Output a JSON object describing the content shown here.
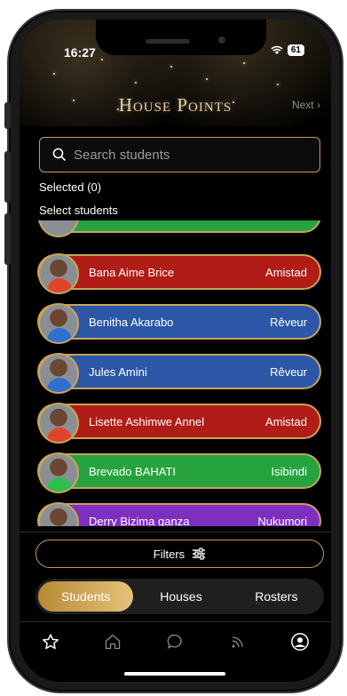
{
  "status": {
    "time": "16:27",
    "battery": "61"
  },
  "header": {
    "title": "House Points",
    "next_label": "Next"
  },
  "search": {
    "placeholder": "Search students"
  },
  "selection": {
    "count_label": "Selected (0)",
    "header": "Select students"
  },
  "students": [
    {
      "name": "Bana Aime Brice",
      "house": "Amistad",
      "color": "#b01c16",
      "shirt": "#e0452a"
    },
    {
      "name": "Benitha Akarabo",
      "house": "Rêveur",
      "color": "#2c57a6",
      "shirt": "#2e6fd0"
    },
    {
      "name": "Jules Amini",
      "house": "Rêveur",
      "color": "#2c57a6",
      "shirt": "#2e6fd0"
    },
    {
      "name": "Lisette Ashimwe Annel",
      "house": "Amistad",
      "color": "#b01c16",
      "shirt": "#e0452a"
    },
    {
      "name": "Brevado BAHATI",
      "house": "Isibindi",
      "color": "#26a33f",
      "shirt": "#2fbe4b"
    },
    {
      "name": "Derry Bizima ganza",
      "house": "Nukumori",
      "color": "#7f2fc0",
      "shirt": "#9b3fe0"
    }
  ],
  "partial_row_color": "#26a33f",
  "filters": {
    "label": "Filters"
  },
  "segments": {
    "students": "Students",
    "houses": "Houses",
    "rosters": "Rosters"
  },
  "tabbar": [
    "star-icon",
    "home-icon",
    "chat-icon",
    "feed-icon",
    "profile-icon"
  ],
  "colors": {
    "accent": "#c79d4d"
  }
}
